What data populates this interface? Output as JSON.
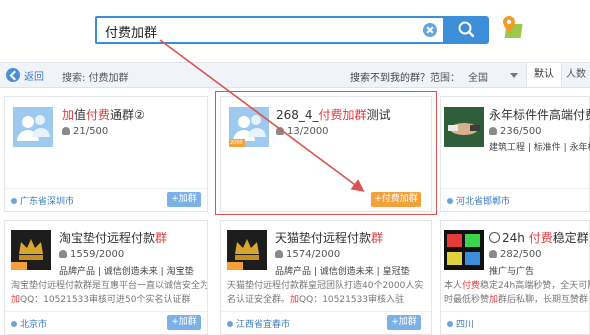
{
  "search": {
    "query": "付费加群"
  },
  "nav": {
    "back": "返回",
    "search_label": "搜索: 付费加群",
    "not_found": "搜索不到我的群？",
    "scope_label": "范围：",
    "scope_value": "全国",
    "tabs": [
      "默认",
      "人数"
    ]
  },
  "cards": [
    {
      "title_pre": "加",
      "title_hl": "值",
      "title_mid": "付费",
      "title_post": "通群②",
      "count": "21/500",
      "location": "广东省深圳市",
      "join": "+加群"
    },
    {
      "title_pre": "268_4_",
      "title_hl": "付费加群",
      "title_post": "测试",
      "count": "13/2000",
      "location": "",
      "join": "+付费加群",
      "badge": "2000"
    },
    {
      "title": "永年标件件高端付费",
      "count": "236/500",
      "tags": [
        "建筑工程",
        "标准件",
        "永年标"
      ],
      "location": "河北省邯郸市",
      "join": "+加群"
    },
    {
      "title_pre": "淘宝垫付远程付款",
      "title_hl": "群",
      "count": "1559/2000",
      "tags": [
        "品牌产品",
        "诚信创造未来",
        "淘宝垫"
      ],
      "desc1_pre": "淘宝垫付远程付款群是互惠平台一直以诚信安全为名",
      "desc2_hl": "加",
      "desc2_post": "QQ：10521533审核可进50个实名认证群",
      "location": "北京市",
      "join": "+加群",
      "badge": "2000"
    },
    {
      "title_pre": "天猫垫付远程付款",
      "title_hl": "群",
      "count": "1574/2000",
      "tags": [
        "品牌产品",
        "诚信创造未来",
        "皇冠垫"
      ],
      "desc1_pre": "天猫垫付远程付款群皇冠团队打造40个2000人实",
      "desc2_pre": "名认证安全群。",
      "desc2_hl": "加",
      "desc2_post": "QQ：10521533审核入驻",
      "location": "江西省宜春市",
      "join": "+加群",
      "badge": "2000"
    },
    {
      "title_pre": "24h ",
      "title_hl": "付费",
      "title_post": "稳定群",
      "count": "282/500",
      "tags": [
        "推广与广告"
      ],
      "desc1_pre": "本人",
      "desc1_hl": "付费",
      "desc1_post": "稳定24h高端秒赞，全天可随",
      "desc2_pre": "时最低秒赞",
      "desc2_hl": "加",
      "desc2_post": "群后私聊，长期互赞群",
      "location": "四川",
      "join": "+加群"
    }
  ],
  "colors": {
    "accent": "#3b8ed8",
    "highlight": "#e4393c",
    "annotation": "#d9534f",
    "join_orange": "#f2a13c"
  }
}
